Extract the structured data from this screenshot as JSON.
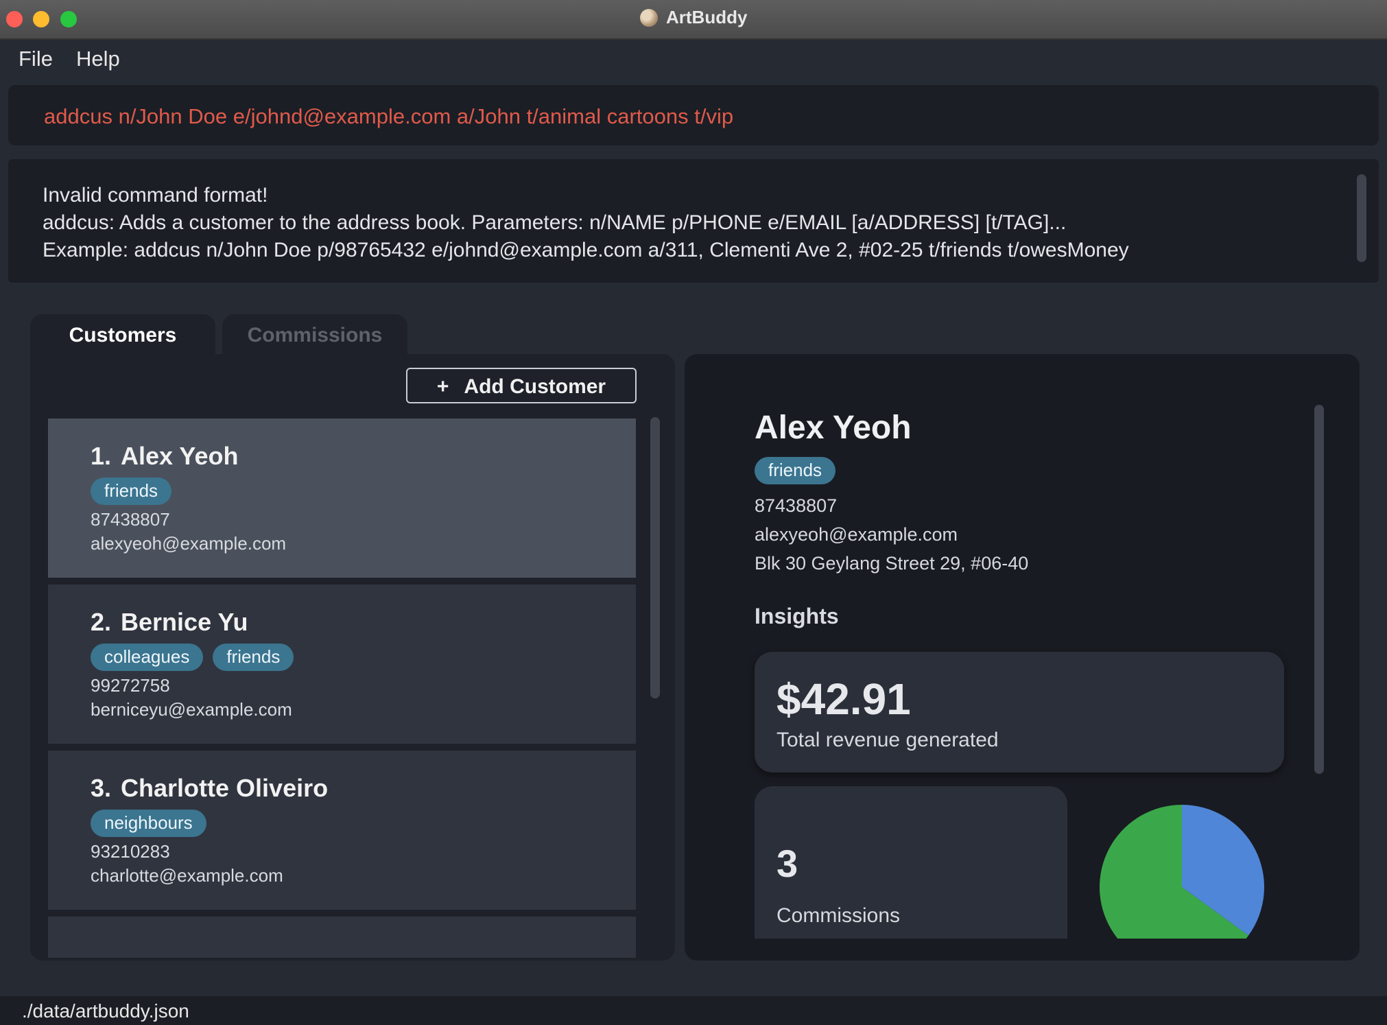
{
  "window": {
    "title": "ArtBuddy"
  },
  "menu": {
    "file": "File",
    "help": "Help"
  },
  "command": {
    "value": "addcus n/John Doe e/johnd@example.com a/John t/animal cartoons t/vip"
  },
  "result": {
    "lines": [
      "Invalid command format!",
      "addcus: Adds a customer to the address book. Parameters: n/NAME p/PHONE e/EMAIL [a/ADDRESS] [t/TAG]...",
      "Example: addcus n/John Doe p/98765432 e/johnd@example.com a/311, Clementi Ave 2, #02-25 t/friends t/owesMoney"
    ]
  },
  "tabs": {
    "customers": "Customers",
    "commissions": "Commissions"
  },
  "add_customer": {
    "icon": "+",
    "label": "Add Customer"
  },
  "customers": [
    {
      "index": "1.",
      "name": "Alex Yeoh",
      "tags": [
        "friends"
      ],
      "phone": "87438807",
      "email": "alexyeoh@example.com"
    },
    {
      "index": "2.",
      "name": "Bernice Yu",
      "tags": [
        "colleagues",
        "friends"
      ],
      "phone": "99272758",
      "email": "berniceyu@example.com"
    },
    {
      "index": "3.",
      "name": "Charlotte Oliveiro",
      "tags": [
        "neighbours"
      ],
      "phone": "93210283",
      "email": "charlotte@example.com"
    }
  ],
  "detail": {
    "name": "Alex Yeoh",
    "tags": [
      "friends"
    ],
    "phone": "87438807",
    "email": "alexyeoh@example.com",
    "address": "Blk 30 Geylang Street 29, #06-40",
    "insights_title": "Insights",
    "revenue_value": "$42.91",
    "revenue_label": "Total revenue generated",
    "commissions_value": "3",
    "commissions_label": "Commissions"
  },
  "pie_chart": {
    "slices": [
      {
        "fraction": 0.35,
        "color": "#4f86d8"
      },
      {
        "fraction": 0.65,
        "color": "#3aa84a"
      }
    ]
  },
  "colors": {
    "accent_tag": "#3b7590",
    "command_text": "#e15a4a",
    "selected_card": "#4b515c"
  },
  "status": {
    "path": "./data/artbuddy.json"
  }
}
